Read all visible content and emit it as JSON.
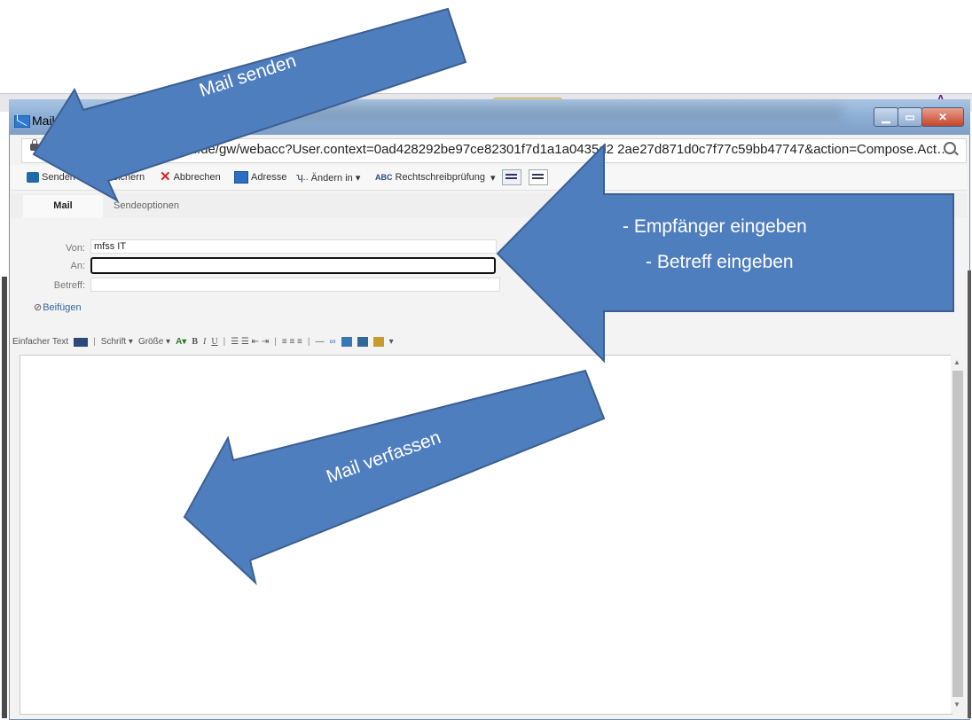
{
  "window": {
    "title": "Mail -",
    "url_prefix": "h",
    "url_visible": "gen.de/gw/webacc?User.context=0ad428292be97ce82301f7d1a1a0435d2  2ae27d871d0c7f77c59bb47747&action=Compose.Act…",
    "background_glyph": "A"
  },
  "toolbar": {
    "send": "Senden",
    "save": "eichern",
    "cancel": "Abbrechen",
    "address": "Adresse",
    "change": "Ändern in ▾",
    "change_glyph": "ʮ..",
    "abc_glyph": "ABC",
    "spell": "Rechtschreibprüfung",
    "spell_arrow": "▾"
  },
  "tabs": {
    "mail": "Mail",
    "send_options": "Sendeoptionen"
  },
  "form": {
    "from_label": "Von:",
    "from_value": "mfss IT",
    "to_label": "An:",
    "to_value": "",
    "subject_label": "Betreff:",
    "subject_value": "",
    "attach": "Beifügen",
    "attach_glyph": "⊘"
  },
  "format_bar": {
    "plain_text": "Einfacher Text",
    "font": "Schrift ▾",
    "size": "Größe ▾",
    "sep": "|",
    "font_color_glyph": "A▾",
    "bold": "B",
    "italic": "I",
    "underline": "U",
    "list_glyphs": "☰ ☰ ⇤ ⇥",
    "align_glyphs": "≡ ≡ ≡",
    "hr_glyph": "—",
    "link_glyph": "∞",
    "table_glyph": "▾"
  },
  "scrollbar": {
    "up": "▲",
    "down": "▼"
  },
  "annotations": {
    "send": "Mail senden",
    "recipient_line1": "- Empfänger eingeben",
    "recipient_line2": "- Betreff eingeben",
    "compose": "Mail verfassen",
    "color": "#4f7ebf",
    "border_color": "#3b5f91"
  }
}
